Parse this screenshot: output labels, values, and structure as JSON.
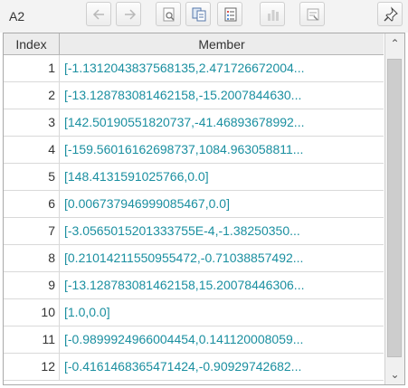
{
  "toolbar": {
    "cell_ref": "A2",
    "buttons": [
      {
        "name": "back-button",
        "icon": "arrow-left-icon"
      },
      {
        "name": "forward-button",
        "icon": "arrow-right-icon"
      },
      {
        "name": "preview-button",
        "icon": "magnifier-page-icon"
      },
      {
        "name": "copy-button",
        "icon": "copy-icon"
      },
      {
        "name": "list-button",
        "icon": "list-icon"
      },
      {
        "name": "chart-button",
        "icon": "bar-chart-icon"
      },
      {
        "name": "properties-button",
        "icon": "properties-icon"
      },
      {
        "name": "pin-button",
        "icon": "pin-icon"
      }
    ]
  },
  "table": {
    "headers": {
      "index": "Index",
      "member": "Member"
    },
    "rows": [
      {
        "index": "1",
        "member": "[-1.1312043837568135,2.471726672004..."
      },
      {
        "index": "2",
        "member": "[-13.128783081462158,-15.2007844630..."
      },
      {
        "index": "3",
        "member": "[142.50190551820737,-41.46893678992..."
      },
      {
        "index": "4",
        "member": "[-159.56016162698737,1084.963058811..."
      },
      {
        "index": "5",
        "member": "[148.4131591025766,0.0]"
      },
      {
        "index": "6",
        "member": "[0.006737946999085467,0.0]"
      },
      {
        "index": "7",
        "member": "[-3.0565015201333755E-4,-1.38250350..."
      },
      {
        "index": "8",
        "member": "[0.21014211550955472,-0.71038857492..."
      },
      {
        "index": "9",
        "member": "[-13.128783081462158,15.20078446306..."
      },
      {
        "index": "10",
        "member": "[1.0,0.0]"
      },
      {
        "index": "11",
        "member": "[-0.9899924966004454,0.141120008059..."
      },
      {
        "index": "12",
        "member": "[-0.4161468365471424,-0.90929742682..."
      }
    ]
  },
  "colors": {
    "member_text": "#1a8fa0",
    "header_bg": "#ececec"
  }
}
